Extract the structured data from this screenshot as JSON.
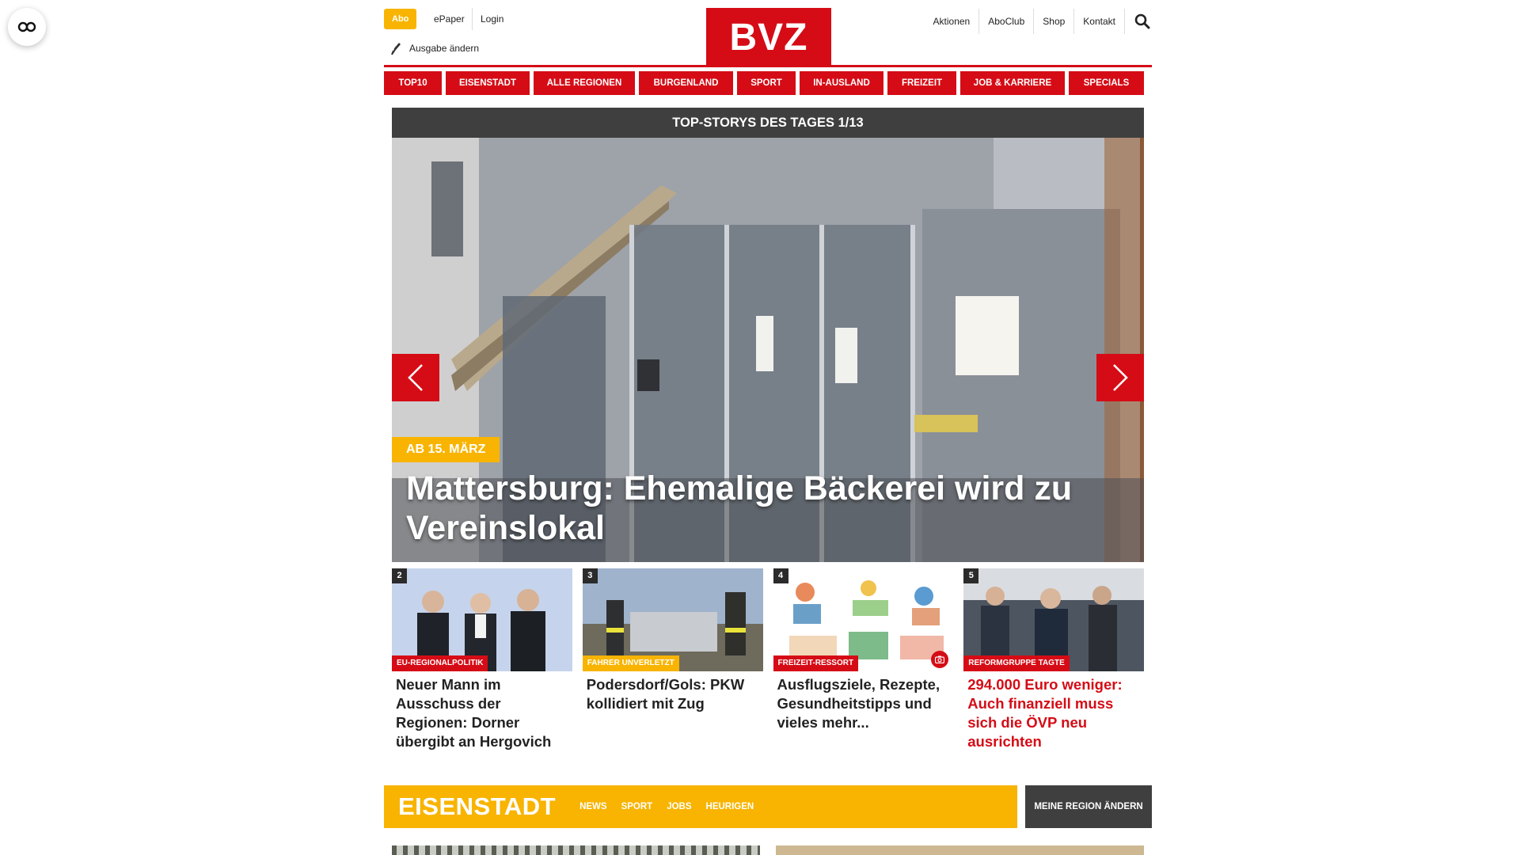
{
  "header": {
    "abo_label": "Abo",
    "epaper_label": "ePaper",
    "login_label": "Login",
    "edition_label": "Ausgabe ändern",
    "logo_text": "BVZ",
    "right_links": [
      "Aktionen",
      "AboClub",
      "Shop",
      "Kontakt"
    ]
  },
  "nav": {
    "items": [
      "TOP10",
      "EISENSTADT",
      "ALLE REGIONEN",
      "BURGENLAND",
      "SPORT",
      "IN-AUSLAND",
      "FREIZEIT",
      "JOB & KARRIERE",
      "SPECIALS"
    ]
  },
  "hero": {
    "heading": "TOP-STORYS DES TAGES 1/13",
    "kicker": "AB 15. MÄRZ",
    "title": "Mattersburg: Ehemalige Bäckerei wird zu Vereinslokal"
  },
  "teasers": [
    {
      "num": "2",
      "tag": "EU-REGIONALPOLITIK",
      "title": "Neuer Mann im Ausschuss der Regionen: Dorner übergibt an Hergovich"
    },
    {
      "num": "3",
      "tag": "FAHRER UNVERLETZT",
      "title": "Podersdorf/Gols: PKW kollidiert mit Zug"
    },
    {
      "num": "4",
      "tag": "FREIZEIT-RESSORT",
      "title": "Ausflugsziele, Rezepte, Gesundheitstipps und vieles mehr..."
    },
    {
      "num": "5",
      "tag": "REFORMGRUPPE TAGTE",
      "title": "294.000 Euro weniger: Auch finanziell muss sich die ÖVP neu ausrichten"
    }
  ],
  "region": {
    "title": "EISENSTADT",
    "links": [
      "NEWS",
      "SPORT",
      "JOBS",
      "HEURIGEN"
    ],
    "change_button": "MEINE REGION ÄNDERN"
  },
  "colors": {
    "brand_red": "#d50c16",
    "accent_yellow": "#f8b400",
    "dark": "#3f3f3f"
  }
}
